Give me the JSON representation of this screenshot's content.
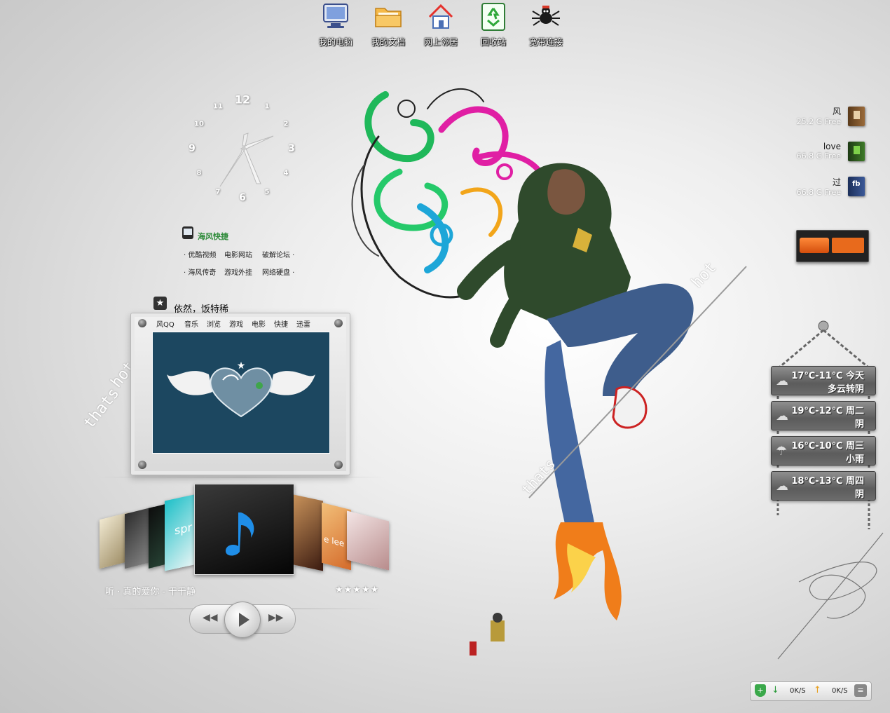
{
  "desktop_icons": [
    {
      "label": "我的电脑",
      "icon": "computer-icon"
    },
    {
      "label": "我的文档",
      "icon": "folder-icon"
    },
    {
      "label": "网上邻居",
      "icon": "network-icon"
    },
    {
      "label": "回收站",
      "icon": "recycle-bin-icon"
    },
    {
      "label": "宽带连接",
      "icon": "broadband-icon"
    }
  ],
  "clock": {
    "numbers": [
      "12",
      "1",
      "2",
      "3",
      "4",
      "5",
      "6",
      "7",
      "8",
      "9",
      "10",
      "11"
    ]
  },
  "links_widget": {
    "title": "海风快捷",
    "items": [
      "优酷视频",
      "电影网站",
      "破解论坛",
      "海风传奇",
      "游戏外挂",
      "网络硬盘"
    ]
  },
  "photo_frame": {
    "title": "依然，饭特稀",
    "tabs": [
      "风QQ",
      "音乐",
      "浏览",
      "游戏",
      "电影",
      "快捷",
      "迅雷"
    ]
  },
  "decorations": {
    "left_text_1": "thats",
    "left_text_2": "hot",
    "right_text_hot": "hot",
    "right_text_thats": "thats"
  },
  "music_player": {
    "now_playing": "听 · 真的爱你 - 千千静",
    "rating": "★★★★★",
    "rating_value": 5,
    "album_text_1": "spr",
    "album_text_2": "e lee"
  },
  "drives": [
    {
      "name": "风",
      "free": "25.2 G Free",
      "icon": "book-brown"
    },
    {
      "name": "love",
      "free": "66.8 G Free",
      "icon": "book-green"
    },
    {
      "name": "过",
      "free": "66.8 G Free",
      "icon": "book-fb"
    }
  ],
  "weather": [
    {
      "temp": "17℃-11℃",
      "day": "今天",
      "cond": "多云转阴"
    },
    {
      "temp": "19℃-12℃",
      "day": "周二",
      "cond": "阴"
    },
    {
      "temp": "16℃-10℃",
      "day": "周三",
      "cond": "小雨"
    },
    {
      "temp": "18℃-13℃",
      "day": "周四",
      "cond": "阴"
    }
  ],
  "net_speed": {
    "down": "0K/S",
    "up": "0K/S"
  },
  "colors": {
    "link_title": "#2e8b3a",
    "frame_pic_bg": "#1c4760",
    "media_orange": "#e86a1c"
  }
}
